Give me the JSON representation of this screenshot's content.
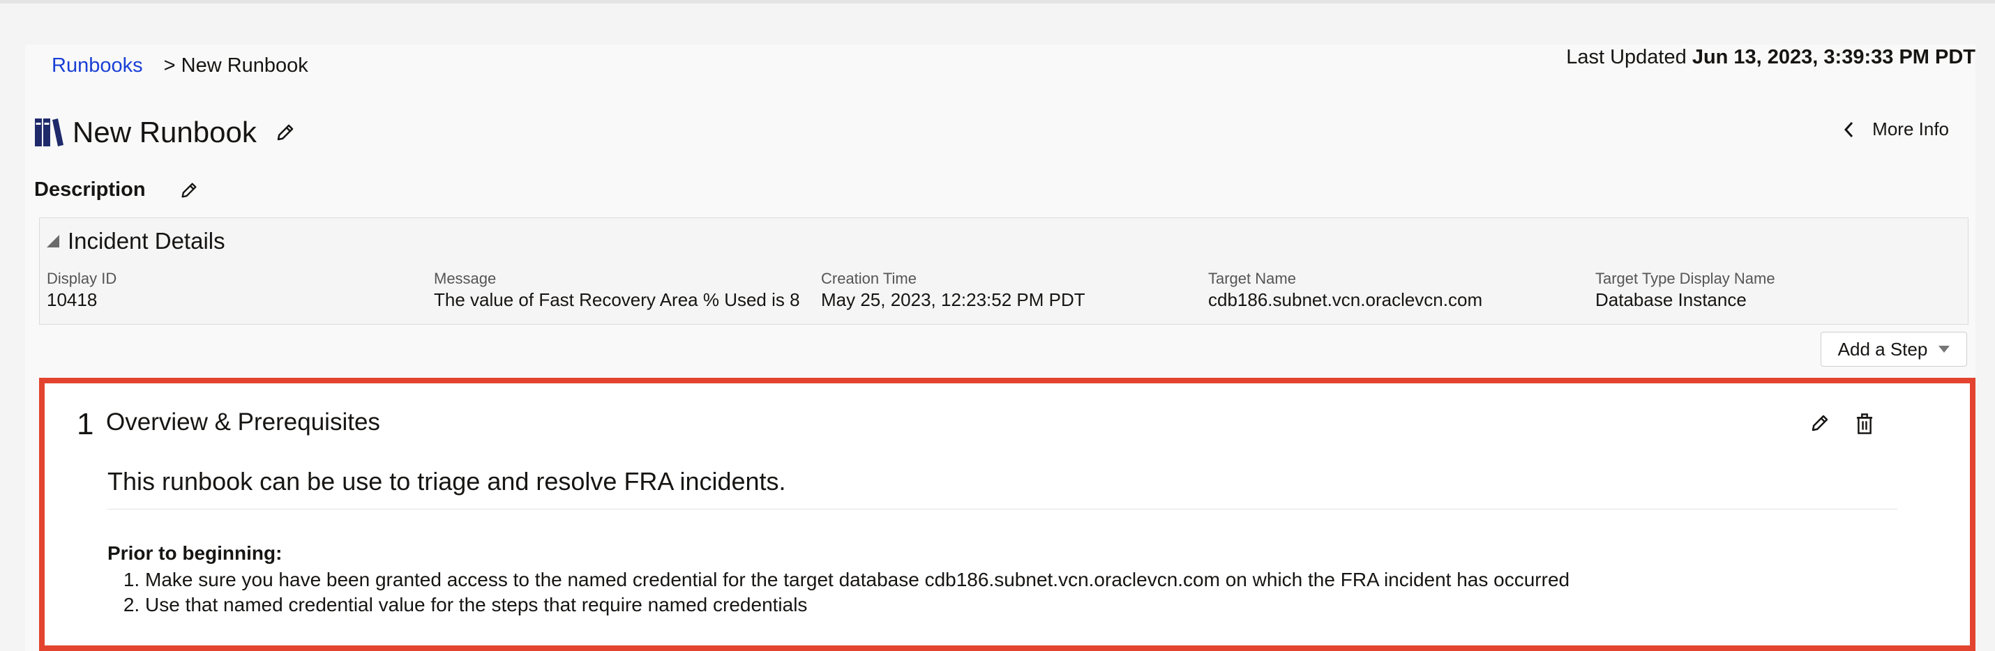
{
  "breadcrumb": {
    "root": "Runbooks",
    "current": "> New Runbook"
  },
  "updated": {
    "label": "Last Updated",
    "value": "Jun 13, 2023, 3:39:33 PM PDT"
  },
  "page": {
    "title": "New Runbook",
    "more_info": "More Info"
  },
  "description": {
    "label": "Description"
  },
  "incident": {
    "title": "Incident Details",
    "fields": [
      {
        "label": "Display ID",
        "value": "10418"
      },
      {
        "label": "Message",
        "value": "The value of Fast Recovery Area % Used is 8"
      },
      {
        "label": "Creation Time",
        "value": "May 25, 2023, 12:23:52 PM PDT"
      },
      {
        "label": "Target Name",
        "value": "cdb186.subnet.vcn.oraclevcn.com"
      },
      {
        "label": "Target Type Display Name",
        "value": "Database Instance"
      }
    ]
  },
  "add_step": {
    "label": "Add a Step"
  },
  "step": {
    "number": "1",
    "title": "Overview & Prerequisites",
    "lead": "This runbook can be use to triage and resolve FRA incidents.",
    "prior_label": "Prior to beginning:",
    "items": [
      "Make sure you have been granted access to the named credential for the target database cdb186.subnet.vcn.oraclevcn.com on which the FRA incident has occurred",
      "Use that named credential value for the steps that require named credentials"
    ]
  },
  "colors": {
    "link": "#1a3fd6",
    "highlight_border": "#e2442f",
    "icon": "#1f2a6b"
  }
}
